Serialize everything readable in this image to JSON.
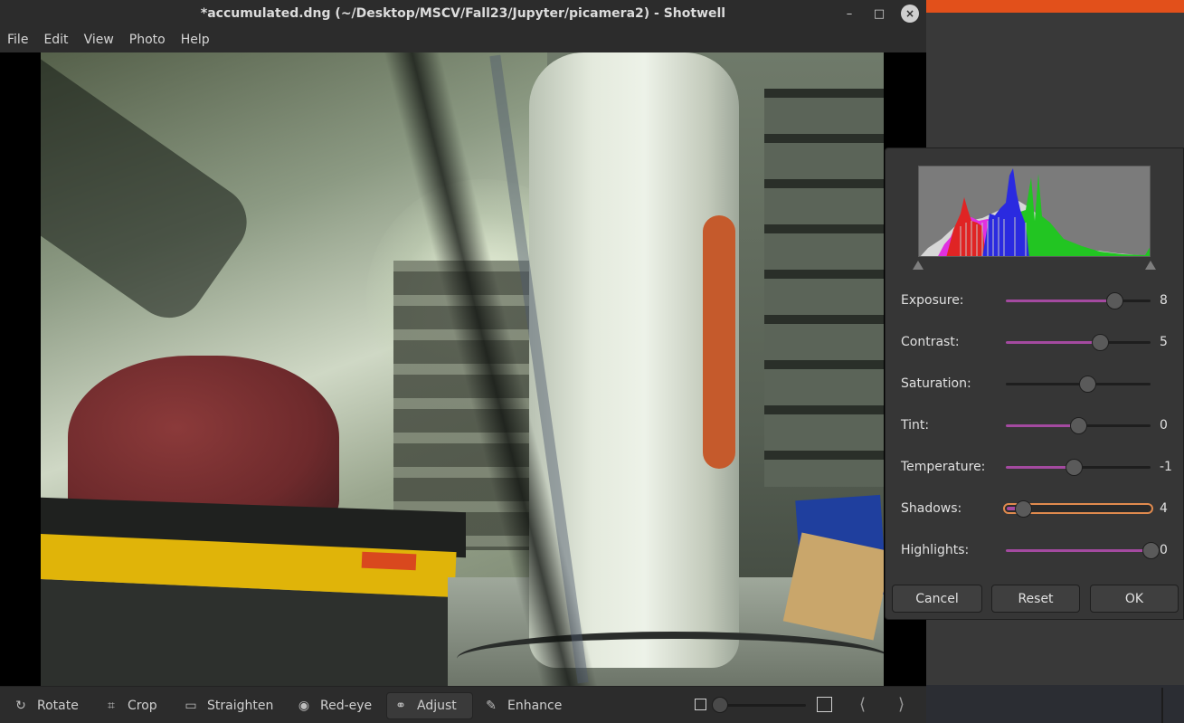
{
  "window": {
    "title": "*accumulated.dng (~/Desktop/MSCV/Fall23/Jupyter/picamera2) - Shotwell",
    "controls": {
      "minimize": "–",
      "maximize": "□",
      "close": "×"
    }
  },
  "menu": [
    {
      "label": "File"
    },
    {
      "label": "Edit"
    },
    {
      "label": "View"
    },
    {
      "label": "Photo"
    },
    {
      "label": "Help"
    }
  ],
  "toolbar": {
    "tools": [
      {
        "label": "Rotate",
        "icon": "rotate-icon",
        "glyph": "↻"
      },
      {
        "label": "Crop",
        "icon": "crop-icon",
        "glyph": "⌗"
      },
      {
        "label": "Straighten",
        "icon": "straighten-icon",
        "glyph": "▭"
      },
      {
        "label": "Red-eye",
        "icon": "eye-icon",
        "glyph": "◉"
      },
      {
        "label": "Adjust",
        "icon": "adjust-icon",
        "glyph": "⚭",
        "active": true
      },
      {
        "label": "Enhance",
        "icon": "wand-icon",
        "glyph": "✎"
      }
    ],
    "zoom_level": 0.0,
    "prev_glyph": "⟨",
    "next_glyph": "⟩"
  },
  "adjust": {
    "sliders": [
      {
        "label": "Exposure:",
        "value": "8",
        "position": 0.75,
        "filled": true
      },
      {
        "label": "Contrast:",
        "value": "5",
        "position": 0.65,
        "filled": true
      },
      {
        "label": "Saturation:",
        "value": "",
        "position": 0.56,
        "filled": false
      },
      {
        "label": "Tint:",
        "value": "0",
        "position": 0.5,
        "filled": true
      },
      {
        "label": "Temperature:",
        "value": "-1",
        "position": 0.47,
        "filled": true
      },
      {
        "label": "Shadows:",
        "value": "4",
        "position": 0.12,
        "filled": true,
        "focused": true
      },
      {
        "label": "Highlights:",
        "value": "0",
        "position": 1.0,
        "filled": true
      }
    ],
    "buttons": {
      "cancel": "Cancel",
      "reset": "Reset",
      "ok": "OK"
    },
    "histogram_markers": {
      "left": 0.0,
      "right": 1.0
    },
    "colors": {
      "slider_fill": "#a44aa0",
      "focus_ring": "#e08a4e",
      "hist_red": "#e02424",
      "hist_green": "#22c522",
      "hist_blue": "#2a2ae0",
      "hist_magenta": "#e030e0"
    }
  },
  "colors": {
    "accent_orange": "#e2501b",
    "window_bg": "#2c2c2c",
    "dialog_bg": "#363636"
  }
}
